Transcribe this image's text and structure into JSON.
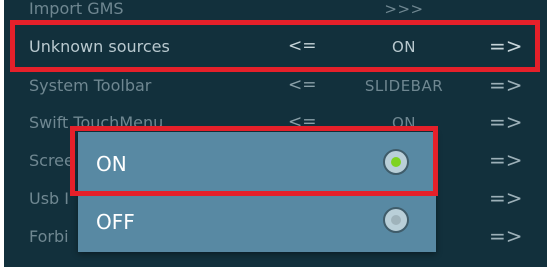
{
  "settings": {
    "rows": [
      {
        "label": "Import GMS",
        "left_arrow": "",
        "value": ">>>",
        "right_arrow": ""
      },
      {
        "label": "Unknown sources",
        "left_arrow": "<=",
        "value": "ON",
        "right_arrow": "=>"
      },
      {
        "label": "System Toolbar",
        "left_arrow": "<=",
        "value": "SLIDEBAR",
        "right_arrow": "=>"
      },
      {
        "label": "Swift TouchMenu",
        "left_arrow": "<=",
        "value": "ON",
        "right_arrow": "=>"
      },
      {
        "label": "Scree",
        "left_arrow": "",
        "value": "",
        "right_arrow": "=>"
      },
      {
        "label": "Usb I",
        "left_arrow": "",
        "value": "",
        "right_arrow": "=>"
      },
      {
        "label": "Forbi",
        "left_arrow": "",
        "value": "",
        "right_arrow": "=>"
      }
    ]
  },
  "dialog": {
    "options": [
      {
        "label": "ON",
        "selected": true
      },
      {
        "label": "OFF",
        "selected": false
      }
    ]
  },
  "colors": {
    "highlight": "#e5202a",
    "dialog_bg": "#5889a3",
    "screen_bg": "#12303c",
    "radio_selected": "#7ed321"
  }
}
